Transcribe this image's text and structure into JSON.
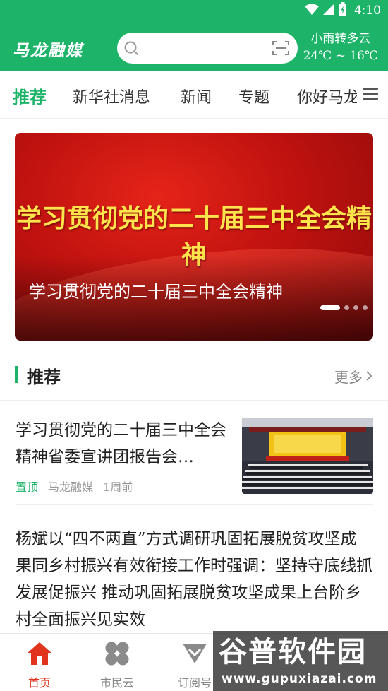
{
  "status_bar": {
    "time": "4:10",
    "icons": [
      "wifi-icon",
      "signal-icon",
      "battery-icon"
    ]
  },
  "header": {
    "logo": "马龙融媒",
    "search": {
      "placeholder": ""
    },
    "weather": {
      "condition": "小雨转多云",
      "temperature": "24℃ ~ 16℃"
    },
    "colors": {
      "brand": "#1db46a"
    }
  },
  "tabs": {
    "items": [
      {
        "label": "推荐",
        "active": true
      },
      {
        "label": "新华社消息"
      },
      {
        "label": "新闻"
      },
      {
        "label": "专题"
      },
      {
        "label": "你好马龙"
      }
    ]
  },
  "banner": {
    "headline": "学习贯彻党的二十届三中全会精神",
    "caption": "学习贯彻党的二十届三中全会精神",
    "slide_count": 4,
    "active_slide": 1
  },
  "section": {
    "title": "推荐",
    "more": "更多"
  },
  "news": [
    {
      "title": "学习贯彻党的二十届三中全会精神省委宣讲团报告会…",
      "pin": "置顶",
      "source": "马龙融媒",
      "time": "1周前"
    },
    {
      "title": "杨斌以“四不两直”方式调研巩固拓展脱贫攻坚成果同乡村振兴有效衔接工作时强调：坚持守底线抓发展促振兴 推动巩固拓展脱贫攻坚成果上台阶乡村全面振兴见实效"
    }
  ],
  "bottom_nav": {
    "items": [
      {
        "label": "首页",
        "icon": "home-icon",
        "active": true
      },
      {
        "label": "市民云",
        "icon": "clover-icon"
      },
      {
        "label": "订阅号",
        "icon": "subscribe-icon"
      }
    ],
    "active_color": "#e0341c"
  },
  "watermark": {
    "logo": "谷普软件园",
    "url": "www.gupuxiazai.com"
  }
}
